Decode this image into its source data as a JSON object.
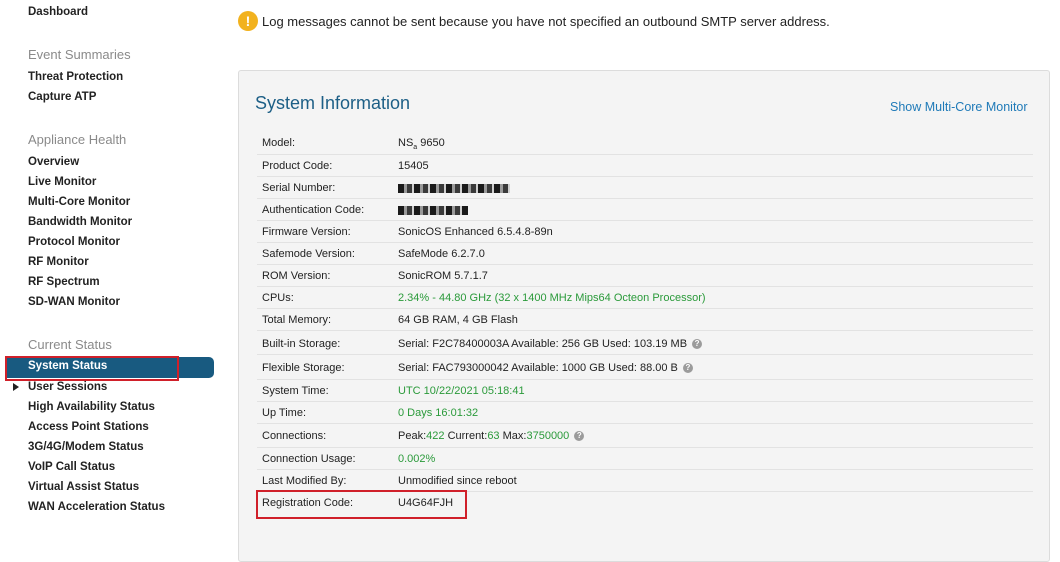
{
  "sidebar": {
    "dashboard": "Dashboard",
    "event_summaries": {
      "heading": "Event Summaries",
      "items": [
        "Threat Protection",
        "Capture ATP"
      ]
    },
    "appliance_health": {
      "heading": "Appliance Health",
      "items": [
        "Overview",
        "Live Monitor",
        "Multi-Core Monitor",
        "Bandwidth Monitor",
        "Protocol Monitor",
        "RF Monitor",
        "RF Spectrum",
        "SD-WAN Monitor"
      ]
    },
    "current_status": {
      "heading": "Current Status",
      "active": "System Status",
      "items": [
        "User Sessions",
        "High Availability Status",
        "Access Point Stations",
        "3G/4G/Modem Status",
        "VoIP Call Status",
        "Virtual Assist Status",
        "WAN Acceleration Status"
      ]
    }
  },
  "warning": {
    "icon": "warning-icon",
    "text": "Log messages cannot be sent because you have not specified an outbound SMTP server address."
  },
  "panel": {
    "title": "System Information",
    "link": "Show Multi-Core Monitor",
    "rows": [
      {
        "label": "Model:",
        "value": "NSa 9650"
      },
      {
        "label": "Product Code:",
        "value": "15405"
      },
      {
        "label": "Serial Number:",
        "value": ""
      },
      {
        "label": "Authentication Code:",
        "value": ""
      },
      {
        "label": "Firmware Version:",
        "value": "SonicOS Enhanced 6.5.4.8-89n"
      },
      {
        "label": "Safemode Version:",
        "value": "SafeMode 6.2.7.0"
      },
      {
        "label": "ROM Version:",
        "value": "SonicROM 5.7.1.7"
      },
      {
        "label": "CPUs:",
        "value": "2.34% - 44.80 GHz (32 x 1400 MHz Mips64 Octeon Processor)"
      },
      {
        "label": "Total Memory:",
        "value": "64 GB RAM, 4 GB Flash"
      },
      {
        "label": "Built-in Storage:",
        "value": "Serial: F2C78400003A Available: 256 GB Used: 103.19 MB"
      },
      {
        "label": "Flexible Storage:",
        "value": "Serial: FAC793000042 Available: 1000 GB Used: 88.00 B"
      },
      {
        "label": "System Time:",
        "value": "UTC 10/22/2021 05:18:41"
      },
      {
        "label": "Up Time:",
        "value": "0 Days 16:01:32"
      },
      {
        "label": "Connections:",
        "peak_label": "Peak:",
        "peak": "422",
        "current_label": "Current:",
        "current": "63",
        "max_label": "Max:",
        "max": "3750000"
      },
      {
        "label": "Connection Usage:",
        "value": "0.002%"
      },
      {
        "label": "Last Modified By:",
        "value": "Unmodified since reboot"
      },
      {
        "label": "Registration Code:",
        "value": "U4G64FJH"
      }
    ],
    "help_glyph": "?"
  },
  "colors": {
    "accent_blue": "#1d5f86",
    "active_nav": "#185a80",
    "highlight_red": "#d0202a",
    "status_green": "#2a9a3a",
    "warning_yellow": "#f2b21e"
  }
}
